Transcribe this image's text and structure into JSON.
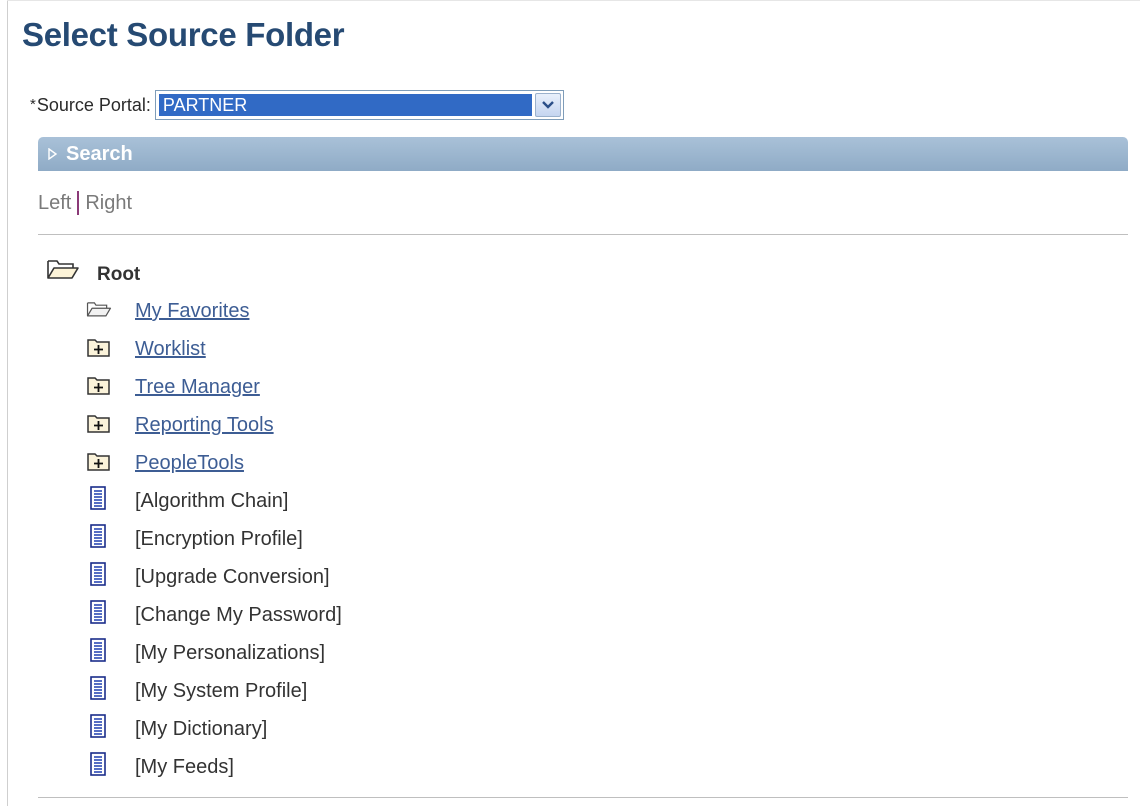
{
  "page": {
    "title": "Select Source Folder"
  },
  "source_portal": {
    "required_mark": "*",
    "label": "Source Portal:",
    "value": "PARTNER"
  },
  "search_section": {
    "label": "Search",
    "state": "collapsed"
  },
  "layout_toggle": {
    "left": "Left",
    "right": "Right"
  },
  "tree": {
    "root": {
      "label": "Root",
      "icon": "folder-open-icon"
    },
    "items": [
      {
        "label": "My Favorites",
        "icon": "folder-open-icon",
        "link": true
      },
      {
        "label": "Worklist",
        "icon": "folder-expand-icon",
        "link": true
      },
      {
        "label": "Tree Manager",
        "icon": "folder-expand-icon",
        "link": true
      },
      {
        "label": "Reporting Tools",
        "icon": "folder-expand-icon",
        "link": true
      },
      {
        "label": "PeopleTools",
        "icon": "folder-expand-icon",
        "link": true
      },
      {
        "label": "[Algorithm Chain]",
        "icon": "content-reference-icon",
        "link": false
      },
      {
        "label": "[Encryption Profile]",
        "icon": "content-reference-icon",
        "link": false
      },
      {
        "label": "[Upgrade Conversion]",
        "icon": "content-reference-icon",
        "link": false
      },
      {
        "label": "[Change My Password]",
        "icon": "content-reference-icon",
        "link": false
      },
      {
        "label": "[My Personalizations]",
        "icon": "content-reference-icon",
        "link": false
      },
      {
        "label": "[My System Profile]",
        "icon": "content-reference-icon",
        "link": false
      },
      {
        "label": "[My Dictionary]",
        "icon": "content-reference-icon",
        "link": false
      },
      {
        "label": "[My Feeds]",
        "icon": "content-reference-icon",
        "link": false
      }
    ]
  },
  "colors": {
    "title": "#264a73",
    "link": "#3d5d94",
    "selection": "#316ac5",
    "search_bar": "#8fabc6",
    "separator": "#8b3a78"
  }
}
